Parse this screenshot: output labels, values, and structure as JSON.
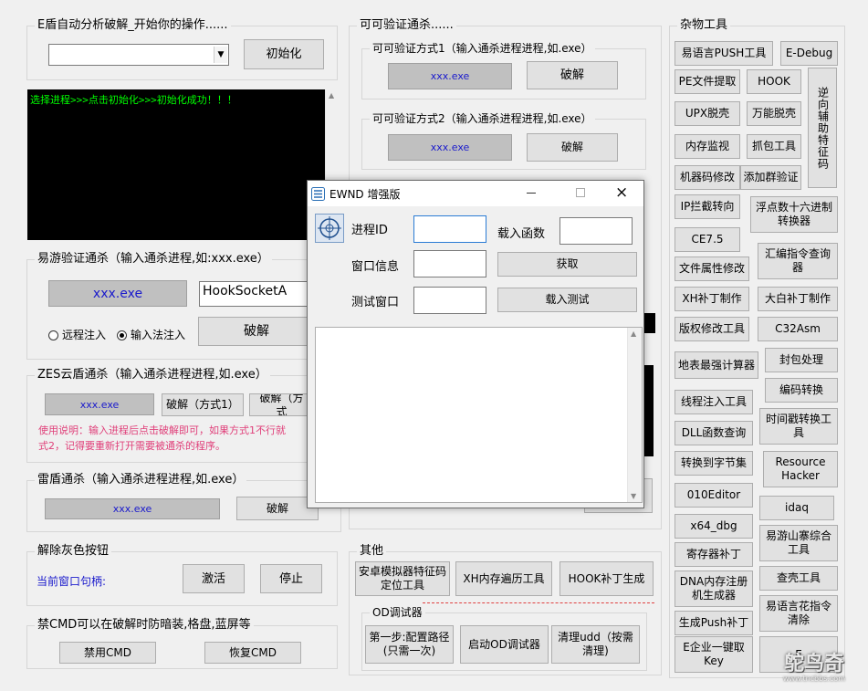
{
  "left": {
    "e_group_title": "E盾自动分析破解_开始你的操作......",
    "e_init_btn": "初始化",
    "console_text": "选择进程>>>点击初始化>>>初始化成功！！！",
    "yiyou_title": "易游验证通杀（输入通杀进程,如:xxx.exe）",
    "yiyou_exe": "xxx.exe",
    "yiyou_api": "HookSocketA",
    "radio_remote": "远程注入",
    "radio_ime": "输入法注入",
    "yiyou_crack": "破解",
    "zes_title": "ZES云盾通杀（输入通杀进程进程,如.exe）",
    "zes_exe": "xxx.exe",
    "zes_btn1": "破解（方式1）",
    "zes_btn2": "破解（方式",
    "zes_note": "使用说明：输入进程后点击破解即可，如果方式1不行就\n式2，记得要重新打开需要被通杀的程序。",
    "lei_title": "雷盾通杀（输入通杀进程进程,如.exe）",
    "lei_exe": "xxx.exe",
    "lei_crack": "破解",
    "gray_title": "解除灰色按钮",
    "gray_label": "当前窗口句柄:",
    "gray_activate": "激活",
    "gray_stop": "停止",
    "cmd_title": "禁CMD可以在破解时防暗装,格盘,蓝屏等",
    "cmd_disable": "禁用CMD",
    "cmd_restore": "恢复CMD"
  },
  "middle": {
    "kk_title": "可可验证通杀......",
    "kk1_title": "可可验证方式1（输入通杀进程进程,如.exe）",
    "kk1_exe": "xxx.exe",
    "kk1_crack": "破解",
    "kk2_title": "可可验证方式2（输入通杀进程进程,如.exe）",
    "kk2_exe": "xxx.exe",
    "kk2_crack": "破解",
    "other_title": "其他",
    "android_btn": "安卓模拟器特征码\n定位工具",
    "xh_btn": "XH内存遍历工具",
    "hook_btn": "HOOK补丁生成",
    "od_title": "OD调试器",
    "od_step1": "第一步:配置路径\n(只需一次)",
    "od_start": "启动OD调试器",
    "od_clear": "清理udd（按需\n清理)"
  },
  "right": {
    "title": "杂物工具",
    "buttons": [
      "易语言PUSH工具",
      "E-Debug",
      "PE文件提取",
      "HOOK",
      "UPX脱壳",
      "万能脱壳",
      "内存监视",
      "抓包工具",
      "机器码修改",
      "添加群验证",
      "IP拦截转向",
      "浮点数十六进制\n转换器",
      "CE7.5",
      "文件属性修改",
      "汇编指令查询\n器",
      "XH补丁制作",
      "大白补丁制作",
      "版权修改工具",
      "C32Asm",
      "地表最强计算器",
      "封包处理",
      "编码转换",
      "线程注入工具",
      "时间戳转换工\n具",
      "DLL函数查询",
      "转换到字节集",
      "Resource\nHacker",
      "010Editor",
      "idaq",
      "x64_dbg",
      "易游山寨综合\n工具",
      "寄存器补丁",
      "查壳工具",
      "DNA内存注册\n机生成器",
      "易语言花指令\n清除",
      "生成Push补丁",
      "E企业一键取\nKey",
      "E"
    ],
    "vertical_btn": "逆向辅助特征码"
  },
  "dialog": {
    "title": "EWND 增强版",
    "pid_label": "进程ID",
    "load_func_label": "载入函数",
    "wininfo_label": "窗口信息",
    "get_btn": "获取",
    "test_label": "测试窗口",
    "load_test_btn": "载入测试"
  },
  "watermark": {
    "text": "鸵鸟奇",
    "url": "www.tncbbs.com"
  }
}
